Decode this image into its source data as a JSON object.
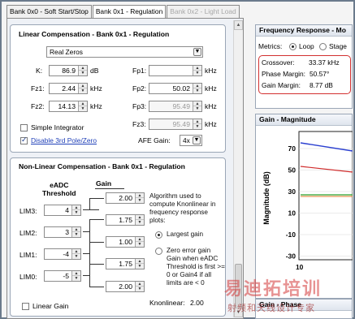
{
  "tabs": [
    {
      "label": "Bank 0x0 - Soft Start/Stop"
    },
    {
      "label": "Bank 0x1 - Regulation"
    },
    {
      "label": "Bank 0x2 - Light Load"
    }
  ],
  "linear": {
    "title": "Linear Compensation - Bank 0x1 - Regulation",
    "mode_select": "Real Zeros",
    "fields": {
      "K": {
        "label": "K:",
        "value": "86.9",
        "unit": "dB"
      },
      "Fp1": {
        "label": "Fp1:",
        "value": "",
        "unit": "kHz"
      },
      "Fz1": {
        "label": "Fz1:",
        "value": "2.44",
        "unit": "kHz"
      },
      "Fp2": {
        "label": "Fp2:",
        "value": "50.02",
        "unit": "kHz"
      },
      "Fz2": {
        "label": "Fz2:",
        "value": "14.13",
        "unit": "kHz"
      },
      "Fp3": {
        "label": "Fp3:",
        "value": "95.49",
        "unit": "kHz"
      },
      "Fz3": {
        "label": "Fz3:",
        "value": "95.49",
        "unit": "kHz"
      }
    },
    "simple_integrator": "Simple Integrator",
    "disable_link": "Disable 3rd Pole/Zero",
    "afe_gain_label": "AFE Gain:",
    "afe_gain_value": "4x"
  },
  "nonlinear": {
    "title": "Non-Linear Compensation - Bank 0x1 - Regulation",
    "col_threshold": "eADC\nThreshold",
    "col_gain": "Gain",
    "rows": [
      {
        "label": "LIM3:",
        "value": "4"
      },
      {
        "label": "LIM2:",
        "value": "3"
      },
      {
        "label": "LIM1:",
        "value": "-4"
      },
      {
        "label": "LIM0:",
        "value": "-5"
      }
    ],
    "gains": [
      "2.00",
      "1.75",
      "1.00",
      "1.75",
      "2.00"
    ],
    "algo_text": "Algorithm used to compute Knonlinear in frequency response plots:",
    "option_largest": "Largest gain",
    "option_zero": "Zero error gain Gain when eADC Threshold is first >= 0 or Gain4 if all limits are < 0",
    "linear_gain": "Linear Gain",
    "knonlinear_label": "Knonlinear:",
    "knonlinear_value": "2.00"
  },
  "freq": {
    "title": "Frequency Response - Mo",
    "metrics_label": "Metrics:",
    "metric_loop": "Loop",
    "metric_stage": "Stage",
    "crossover_label": "Crossover:",
    "crossover_value": "33.37 kHz",
    "phase_label": "Phase Margin:",
    "phase_value": "50.57°",
    "gain_label": "Gain Margin:",
    "gain_value": "8.77 dB"
  },
  "magnitude": {
    "title": "Gain - Magnitude",
    "ylabel": "Magnitude (dB)",
    "yticks": [
      "70",
      "50",
      "30",
      "10",
      "-10",
      "-30"
    ],
    "xtick": "10",
    "colors": {
      "blue": "#2a3fd0",
      "red": "#d02a2a",
      "green": "#2aa02a",
      "orange": "#e07a2a"
    }
  },
  "phase": {
    "title": "Gain - Phase"
  },
  "watermark": {
    "line1": "易迪拓培训",
    "line2": "射频和天线设计专家"
  }
}
